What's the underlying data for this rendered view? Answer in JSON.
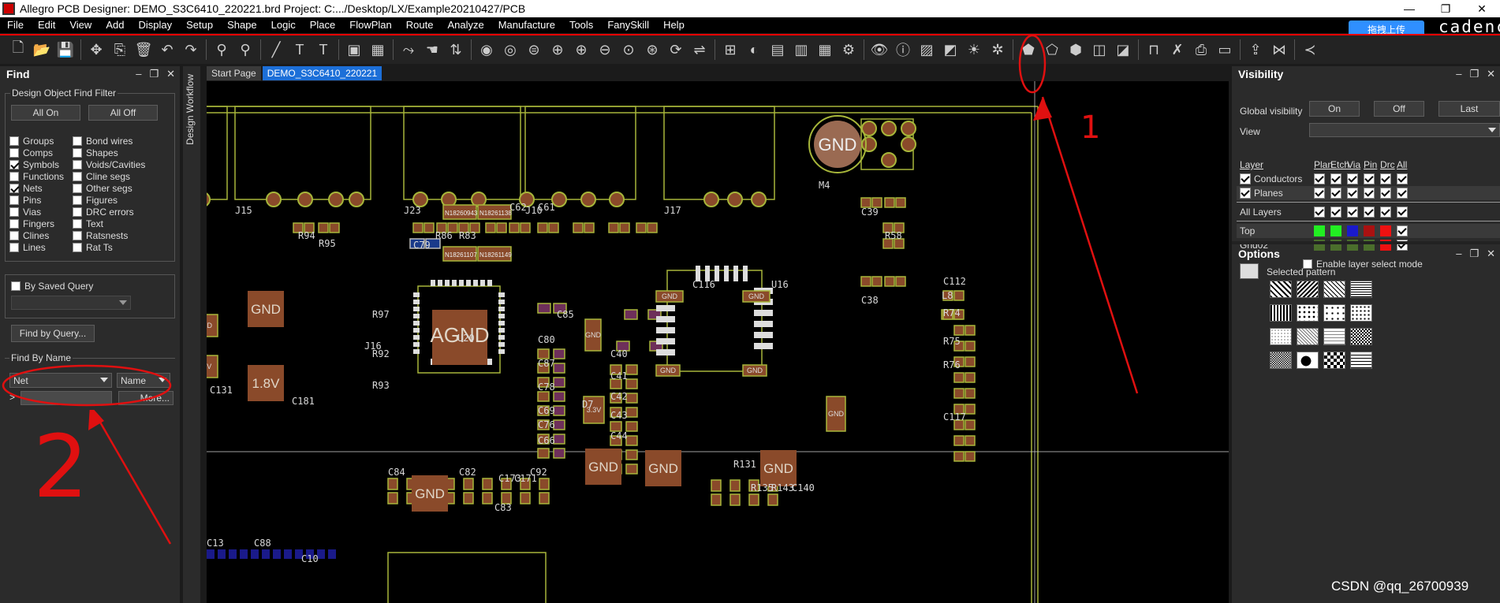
{
  "window": {
    "title": "Allegro PCB Designer: DEMO_S3C6410_220221.brd  Project: C:.../Desktop/LX/Example20210427/PCB",
    "minimize": "—",
    "restore": "❐",
    "close": "✕"
  },
  "menu": [
    "File",
    "Edit",
    "View",
    "Add",
    "Display",
    "Setup",
    "Shape",
    "Logic",
    "Place",
    "FlowPlan",
    "Route",
    "Analyze",
    "Manufacture",
    "Tools",
    "FanySkill",
    "Help"
  ],
  "upload_label": "拖拽上传",
  "brand": "cadenc",
  "find_panel": {
    "title": "Find",
    "filter_title": "Design Object Find Filter",
    "all_on": "All On",
    "all_off": "All Off",
    "left_items": [
      {
        "label": "Groups",
        "checked": false
      },
      {
        "label": "Comps",
        "checked": false
      },
      {
        "label": "Symbols",
        "checked": true
      },
      {
        "label": "Functions",
        "checked": false
      },
      {
        "label": "Nets",
        "checked": true
      },
      {
        "label": "Pins",
        "checked": false
      },
      {
        "label": "Vias",
        "checked": false
      },
      {
        "label": "Fingers",
        "checked": false
      },
      {
        "label": "Clines",
        "checked": false
      },
      {
        "label": "Lines",
        "checked": false
      }
    ],
    "right_items": [
      {
        "label": "Bond wires",
        "checked": false
      },
      {
        "label": "Shapes",
        "checked": false
      },
      {
        "label": "Voids/Cavities",
        "checked": false
      },
      {
        "label": "Cline segs",
        "checked": false
      },
      {
        "label": "Other segs",
        "checked": false
      },
      {
        "label": "Figures",
        "checked": false
      },
      {
        "label": "DRC errors",
        "checked": false
      },
      {
        "label": "Text",
        "checked": false
      },
      {
        "label": "Ratsnests",
        "checked": false
      },
      {
        "label": "Rat Ts",
        "checked": false
      }
    ],
    "saved_query": "By Saved Query",
    "find_by_query": "Find by Query...",
    "find_by_name": "Find By Name",
    "type_value": "Net",
    "mode_value": "Name",
    "more": "More...",
    "prompt": ">"
  },
  "workflow_label": "Design Workflow",
  "tabs": [
    "Start Page",
    "DEMO_S3C6410_220221"
  ],
  "visibility": {
    "title": "Visibility",
    "global_label": "Global visibility",
    "on": "On",
    "off": "Off",
    "last": "Last",
    "view_label": "View",
    "header": {
      "layer": "Layer",
      "plan": "Plan",
      "etch": "Etch",
      "via": "Via",
      "pin": "Pin",
      "drc": "Drc",
      "all": "All"
    },
    "conductors": "Conductors",
    "planes": "Planes",
    "all_layers": "All Layers",
    "top": "Top",
    "gnd02": "Gnd02",
    "top_colors": [
      "#22ee22",
      "#22ee22",
      "#1a1acc",
      "#aa1111",
      "#ee1111"
    ],
    "gnd02_colors": [
      "#4b6e2c",
      "#4b6e2c",
      "#4b6e2c",
      "#4b6e2c",
      "#ee1111"
    ],
    "enable_select": "Enable layer select mode"
  },
  "options": {
    "title": "Options",
    "selected_pattern": "Selected pattern"
  },
  "pcb": {
    "big_labels": [
      "GND",
      "1.8V",
      "AGND",
      "GND",
      "GND",
      "GND",
      "GND",
      "GND",
      "GND"
    ],
    "small_labels": [
      "GND",
      "3.3V",
      "GND",
      "3.3V",
      "GND",
      "GND",
      "GND",
      "GND",
      "GND"
    ],
    "refdes": [
      "J15",
      "J23",
      "J10",
      "J17",
      "M4",
      "R94",
      "R95",
      "C79",
      "R86",
      "R83",
      "C62",
      "C61",
      "C39",
      "R58",
      "C38",
      "C116",
      "U16",
      "C112",
      "R74",
      "R75",
      "R76",
      "C117",
      "L8",
      "C85",
      "J16",
      "R97",
      "R92",
      "R93",
      "U20",
      "C80",
      "C87",
      "C78",
      "C69",
      "C76",
      "C66",
      "C40",
      "C41",
      "C42",
      "C43",
      "C44",
      "D7",
      "C131",
      "C181",
      "R131",
      "R135",
      "R143",
      "C140",
      "C84",
      "C82",
      "C92",
      "C83",
      "C13",
      "C88",
      "C10",
      "C173",
      "C171"
    ],
    "n_parts": [
      "N18260943",
      "N18261138",
      "N18261107",
      "N18261149"
    ]
  },
  "annotations": {
    "one": "1",
    "two": "2"
  },
  "watermark": "CSDN @qq_26700939"
}
